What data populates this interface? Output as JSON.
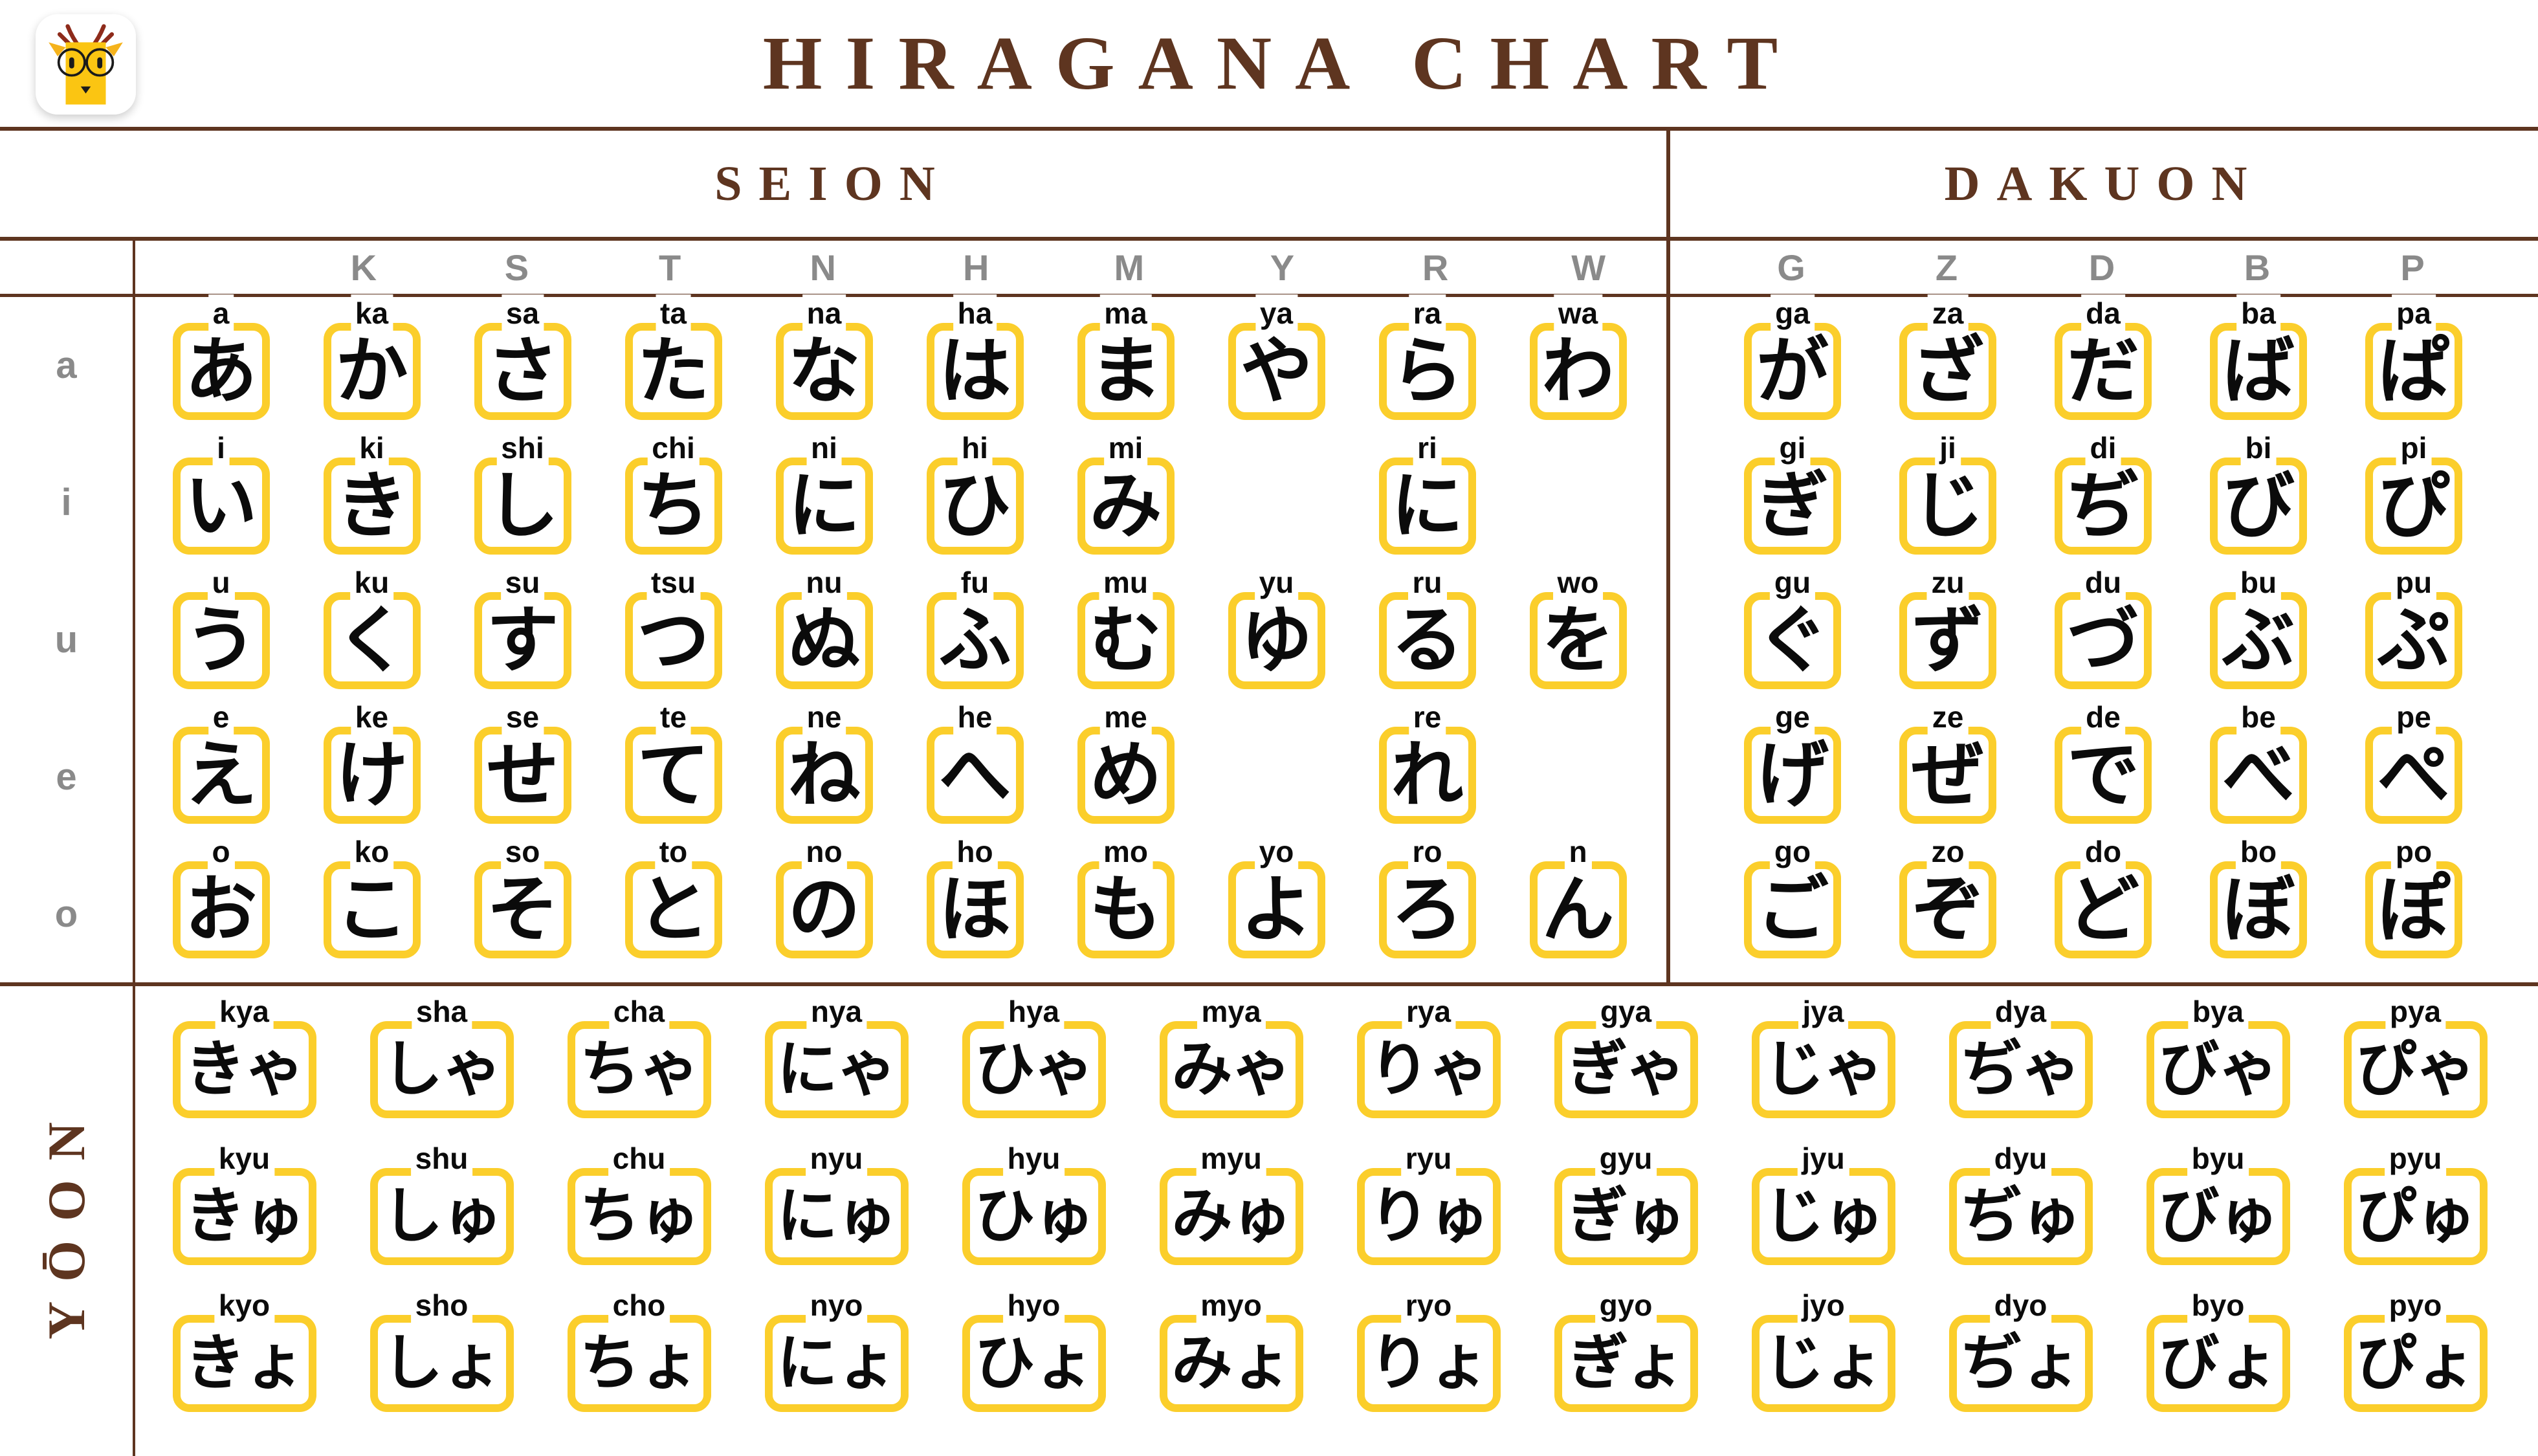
{
  "header": {
    "title": "HIRAGANA CHART",
    "logo_name": "owl-mascot-logo",
    "accent_color": "#fbce2b",
    "brand_color": "#5e3520",
    "label_gray": "#8a8a8a"
  },
  "sections": {
    "seion": "SEION",
    "dakuon": "DAKUON",
    "yoon": "YŌON"
  },
  "columns": {
    "seion": [
      "",
      "K",
      "S",
      "T",
      "N",
      "H",
      "M",
      "Y",
      "R",
      "W"
    ],
    "dakuon": [
      "G",
      "Z",
      "D",
      "B",
      "P"
    ]
  },
  "rows": {
    "vowels": [
      "a",
      "i",
      "u",
      "e",
      "o"
    ]
  },
  "seion_grid": [
    [
      {
        "kana": "あ",
        "romaji": "a"
      },
      {
        "kana": "か",
        "romaji": "ka"
      },
      {
        "kana": "さ",
        "romaji": "sa"
      },
      {
        "kana": "た",
        "romaji": "ta"
      },
      {
        "kana": "な",
        "romaji": "na"
      },
      {
        "kana": "は",
        "romaji": "ha"
      },
      {
        "kana": "ま",
        "romaji": "ma"
      },
      {
        "kana": "や",
        "romaji": "ya"
      },
      {
        "kana": "ら",
        "romaji": "ra"
      },
      {
        "kana": "わ",
        "romaji": "wa"
      }
    ],
    [
      {
        "kana": "い",
        "romaji": "i"
      },
      {
        "kana": "き",
        "romaji": "ki"
      },
      {
        "kana": "し",
        "romaji": "shi"
      },
      {
        "kana": "ち",
        "romaji": "chi"
      },
      {
        "kana": "に",
        "romaji": "ni"
      },
      {
        "kana": "ひ",
        "romaji": "hi"
      },
      {
        "kana": "み",
        "romaji": "mi"
      },
      null,
      {
        "kana": "に",
        "romaji": "ri"
      },
      null
    ],
    [
      {
        "kana": "う",
        "romaji": "u"
      },
      {
        "kana": "く",
        "romaji": "ku"
      },
      {
        "kana": "す",
        "romaji": "su"
      },
      {
        "kana": "つ",
        "romaji": "tsu"
      },
      {
        "kana": "ぬ",
        "romaji": "nu"
      },
      {
        "kana": "ふ",
        "romaji": "fu"
      },
      {
        "kana": "む",
        "romaji": "mu"
      },
      {
        "kana": "ゆ",
        "romaji": "yu"
      },
      {
        "kana": "る",
        "romaji": "ru"
      },
      {
        "kana": "を",
        "romaji": "wo"
      }
    ],
    [
      {
        "kana": "え",
        "romaji": "e"
      },
      {
        "kana": "け",
        "romaji": "ke"
      },
      {
        "kana": "せ",
        "romaji": "se"
      },
      {
        "kana": "て",
        "romaji": "te"
      },
      {
        "kana": "ね",
        "romaji": "ne"
      },
      {
        "kana": "へ",
        "romaji": "he"
      },
      {
        "kana": "め",
        "romaji": "me"
      },
      null,
      {
        "kana": "れ",
        "romaji": "re"
      },
      null
    ],
    [
      {
        "kana": "お",
        "romaji": "o"
      },
      {
        "kana": "こ",
        "romaji": "ko"
      },
      {
        "kana": "そ",
        "romaji": "so"
      },
      {
        "kana": "と",
        "romaji": "to"
      },
      {
        "kana": "の",
        "romaji": "no"
      },
      {
        "kana": "ほ",
        "romaji": "ho"
      },
      {
        "kana": "も",
        "romaji": "mo"
      },
      {
        "kana": "よ",
        "romaji": "yo"
      },
      {
        "kana": "ろ",
        "romaji": "ro"
      },
      {
        "kana": "ん",
        "romaji": "n"
      }
    ]
  ],
  "dakuon_grid": [
    [
      {
        "kana": "が",
        "romaji": "ga"
      },
      {
        "kana": "ざ",
        "romaji": "za"
      },
      {
        "kana": "だ",
        "romaji": "da"
      },
      {
        "kana": "ば",
        "romaji": "ba"
      },
      {
        "kana": "ぱ",
        "romaji": "pa"
      }
    ],
    [
      {
        "kana": "ぎ",
        "romaji": "gi"
      },
      {
        "kana": "じ",
        "romaji": "ji"
      },
      {
        "kana": "ぢ",
        "romaji": "di"
      },
      {
        "kana": "び",
        "romaji": "bi"
      },
      {
        "kana": "ぴ",
        "romaji": "pi"
      }
    ],
    [
      {
        "kana": "ぐ",
        "romaji": "gu"
      },
      {
        "kana": "ず",
        "romaji": "zu"
      },
      {
        "kana": "づ",
        "romaji": "du"
      },
      {
        "kana": "ぶ",
        "romaji": "bu"
      },
      {
        "kana": "ぷ",
        "romaji": "pu"
      }
    ],
    [
      {
        "kana": "げ",
        "romaji": "ge"
      },
      {
        "kana": "ぜ",
        "romaji": "ze"
      },
      {
        "kana": "で",
        "romaji": "de"
      },
      {
        "kana": "べ",
        "romaji": "be"
      },
      {
        "kana": "ぺ",
        "romaji": "pe"
      }
    ],
    [
      {
        "kana": "ご",
        "romaji": "go"
      },
      {
        "kana": "ぞ",
        "romaji": "zo"
      },
      {
        "kana": "ど",
        "romaji": "do"
      },
      {
        "kana": "ぼ",
        "romaji": "bo"
      },
      {
        "kana": "ぽ",
        "romaji": "po"
      }
    ]
  ],
  "yoon_grid": [
    [
      {
        "kana": "きゃ",
        "romaji": "kya"
      },
      {
        "kana": "しゃ",
        "romaji": "sha"
      },
      {
        "kana": "ちゃ",
        "romaji": "cha"
      },
      {
        "kana": "にゃ",
        "romaji": "nya"
      },
      {
        "kana": "ひゃ",
        "romaji": "hya"
      },
      {
        "kana": "みゃ",
        "romaji": "mya"
      },
      {
        "kana": "りゃ",
        "romaji": "rya"
      },
      {
        "kana": "ぎゃ",
        "romaji": "gya"
      },
      {
        "kana": "じゃ",
        "romaji": "jya"
      },
      {
        "kana": "ぢゃ",
        "romaji": "dya"
      },
      {
        "kana": "びゃ",
        "romaji": "bya"
      },
      {
        "kana": "ぴゃ",
        "romaji": "pya"
      }
    ],
    [
      {
        "kana": "きゅ",
        "romaji": "kyu"
      },
      {
        "kana": "しゅ",
        "romaji": "shu"
      },
      {
        "kana": "ちゅ",
        "romaji": "chu"
      },
      {
        "kana": "にゅ",
        "romaji": "nyu"
      },
      {
        "kana": "ひゅ",
        "romaji": "hyu"
      },
      {
        "kana": "みゅ",
        "romaji": "myu"
      },
      {
        "kana": "りゅ",
        "romaji": "ryu"
      },
      {
        "kana": "ぎゅ",
        "romaji": "gyu"
      },
      {
        "kana": "じゅ",
        "romaji": "jyu"
      },
      {
        "kana": "ぢゅ",
        "romaji": "dyu"
      },
      {
        "kana": "びゅ",
        "romaji": "byu"
      },
      {
        "kana": "ぴゅ",
        "romaji": "pyu"
      }
    ],
    [
      {
        "kana": "きょ",
        "romaji": "kyo"
      },
      {
        "kana": "しょ",
        "romaji": "sho"
      },
      {
        "kana": "ちょ",
        "romaji": "cho"
      },
      {
        "kana": "にょ",
        "romaji": "nyo"
      },
      {
        "kana": "ひょ",
        "romaji": "hyo"
      },
      {
        "kana": "みょ",
        "romaji": "myo"
      },
      {
        "kana": "りょ",
        "romaji": "ryo"
      },
      {
        "kana": "ぎょ",
        "romaji": "gyo"
      },
      {
        "kana": "じょ",
        "romaji": "jyo"
      },
      {
        "kana": "ぢょ",
        "romaji": "dyo"
      },
      {
        "kana": "びょ",
        "romaji": "byo"
      },
      {
        "kana": "ぴょ",
        "romaji": "pyo"
      }
    ]
  ]
}
